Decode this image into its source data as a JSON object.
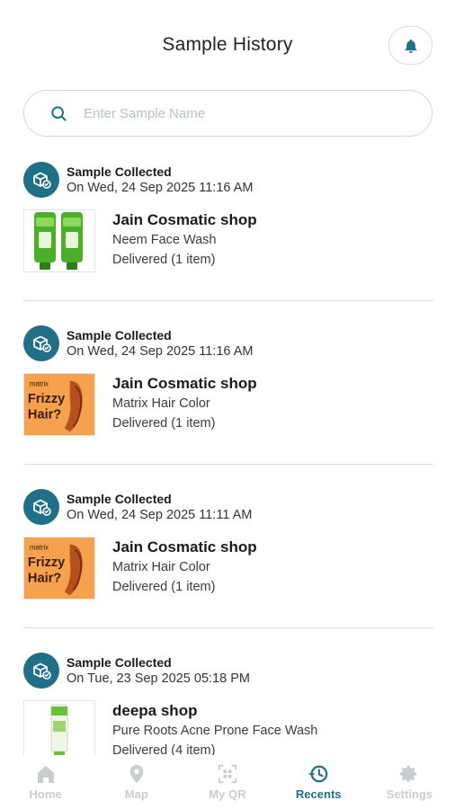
{
  "header": {
    "title": "Sample History",
    "notifications_icon": "bell-icon"
  },
  "search": {
    "placeholder": "Enter Sample Name",
    "icon": "search-icon"
  },
  "colors": {
    "accent": "#1f6f86",
    "inactive_tab": "#c9cdcf",
    "divider": "#dcdcdc"
  },
  "entries": [
    {
      "status": "Sample Collected",
      "date": "On Wed, 24 Sep 2025 11:16 AM",
      "shop": "Jain Cosmatic shop",
      "product": "Neem Face Wash",
      "delivery": "Delivered (1 item)",
      "image": "neem-face-wash-image"
    },
    {
      "status": "Sample Collected",
      "date": "On Wed, 24 Sep 2025 11:16 AM",
      "shop": "Jain Cosmatic shop",
      "product": "Matrix Hair Color",
      "delivery": "Delivered (1 item)",
      "image": "matrix-hair-color-image"
    },
    {
      "status": "Sample Collected",
      "date": "On Wed, 24 Sep 2025 11:11 AM",
      "shop": "Jain Cosmatic shop",
      "product": "Matrix Hair Color",
      "delivery": "Delivered (1 item)",
      "image": "matrix-hair-color-image"
    },
    {
      "status": "Sample Collected",
      "date": "On Tue, 23 Sep 2025 05:18 PM",
      "shop": "deepa shop",
      "product": "Pure Roots Acne Prone Face Wash",
      "delivery": "Delivered (4 item)",
      "image": "face-wash-tube-image"
    }
  ],
  "matrix_art": {
    "line1": "matrix",
    "line2": "Frizzy",
    "line3": "Hair?"
  },
  "tabs": [
    {
      "label": "Home",
      "icon": "home-icon",
      "active": false
    },
    {
      "label": "Map",
      "icon": "map-pin-icon",
      "active": false
    },
    {
      "label": "My QR",
      "icon": "qr-scan-icon",
      "active": false
    },
    {
      "label": "Recents",
      "icon": "history-icon",
      "active": true
    },
    {
      "label": "Settings",
      "icon": "gear-icon",
      "active": false
    }
  ]
}
